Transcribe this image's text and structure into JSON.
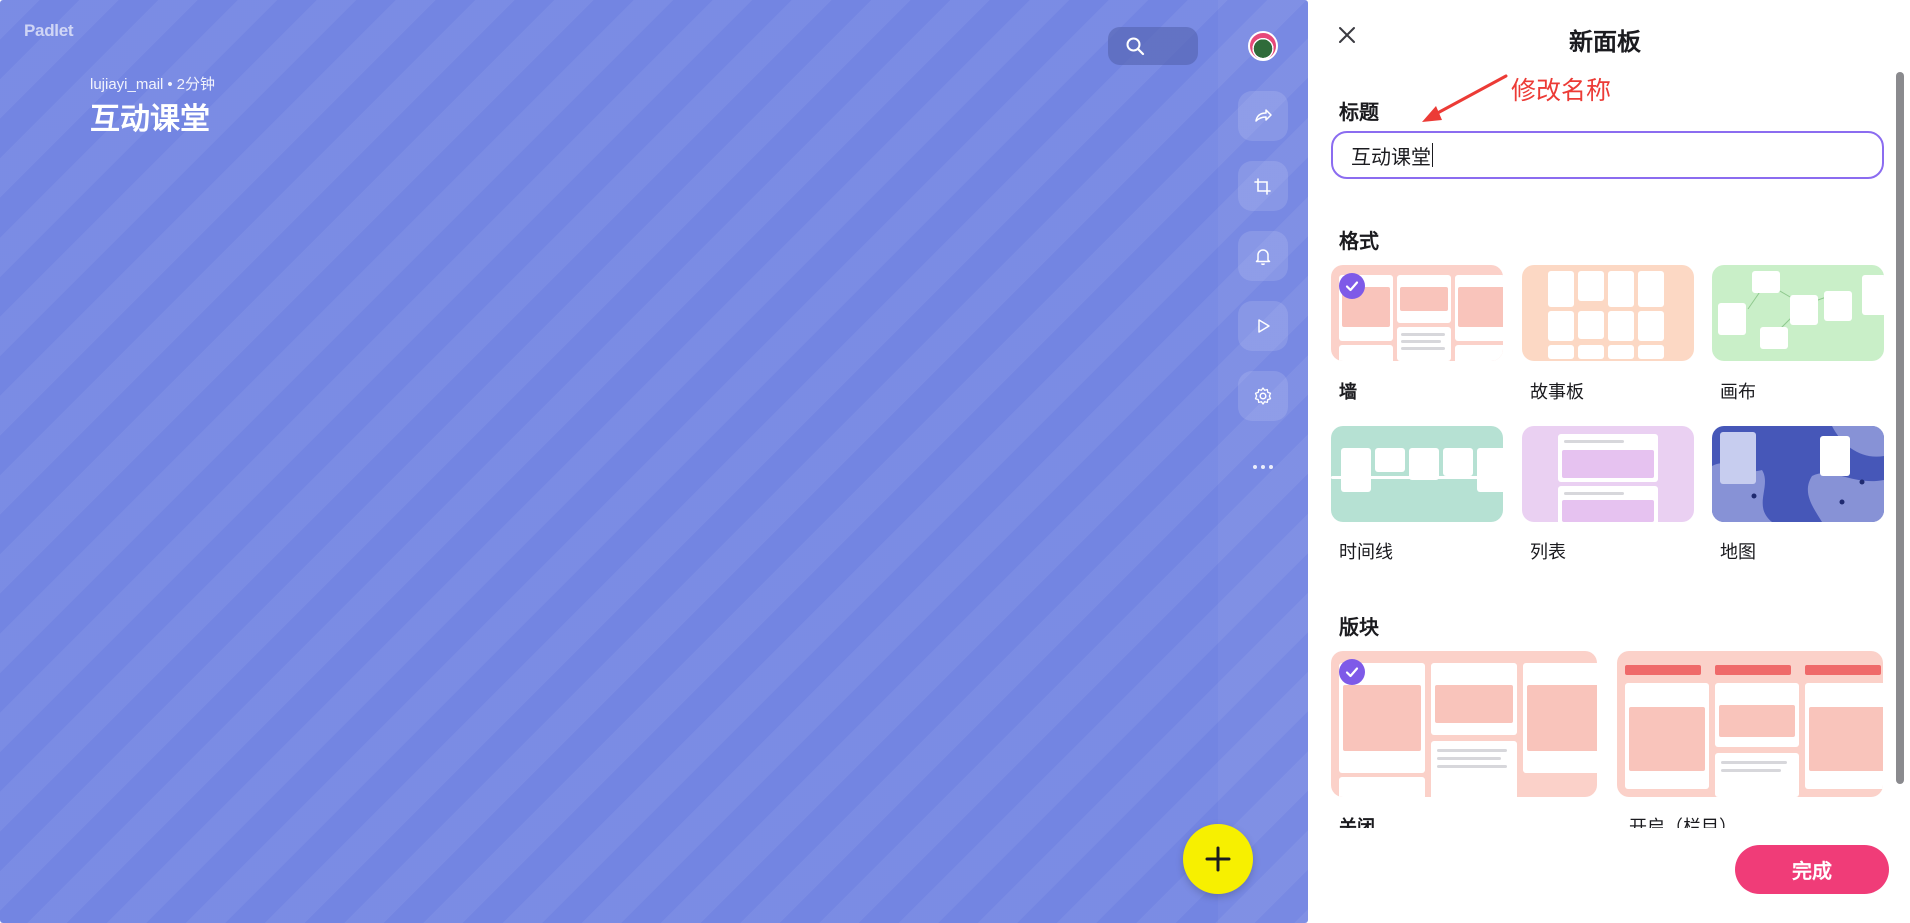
{
  "board": {
    "logo": "Padlet",
    "author": "lujiayi_mail",
    "separator": "•",
    "time_ago": "2分钟",
    "title": "互动课堂",
    "background_color": "#7385e2",
    "rail_icons": [
      "share-icon",
      "remix-icon",
      "bell-icon",
      "play-icon",
      "gear-icon",
      "more-icon"
    ],
    "fab_color": "#f7f000"
  },
  "panel": {
    "title": "新面板",
    "title_section_label": "标题",
    "title_value": "互动课堂",
    "annotation": "修改名称",
    "format_section_label": "格式",
    "formats": [
      {
        "label": "墙",
        "selected": true,
        "color": "#fbd1c9"
      },
      {
        "label": "故事板",
        "selected": false,
        "color": "#fcd8c4"
      },
      {
        "label": "画布",
        "selected": false,
        "color": "#c9efc8"
      },
      {
        "label": "时间线",
        "selected": false,
        "color": "#b6e1d3"
      },
      {
        "label": "列表",
        "selected": false,
        "color": "#ead0f2"
      },
      {
        "label": "地图",
        "selected": false,
        "color": "#4657b8"
      }
    ],
    "sections_section_label": "版块",
    "sections": [
      {
        "label": "关闭",
        "selected": true
      },
      {
        "label": "开启（栏目）",
        "selected": false
      }
    ],
    "done_label": "完成",
    "accent_color": "#8b6cf0",
    "done_color": "#f03c78"
  }
}
